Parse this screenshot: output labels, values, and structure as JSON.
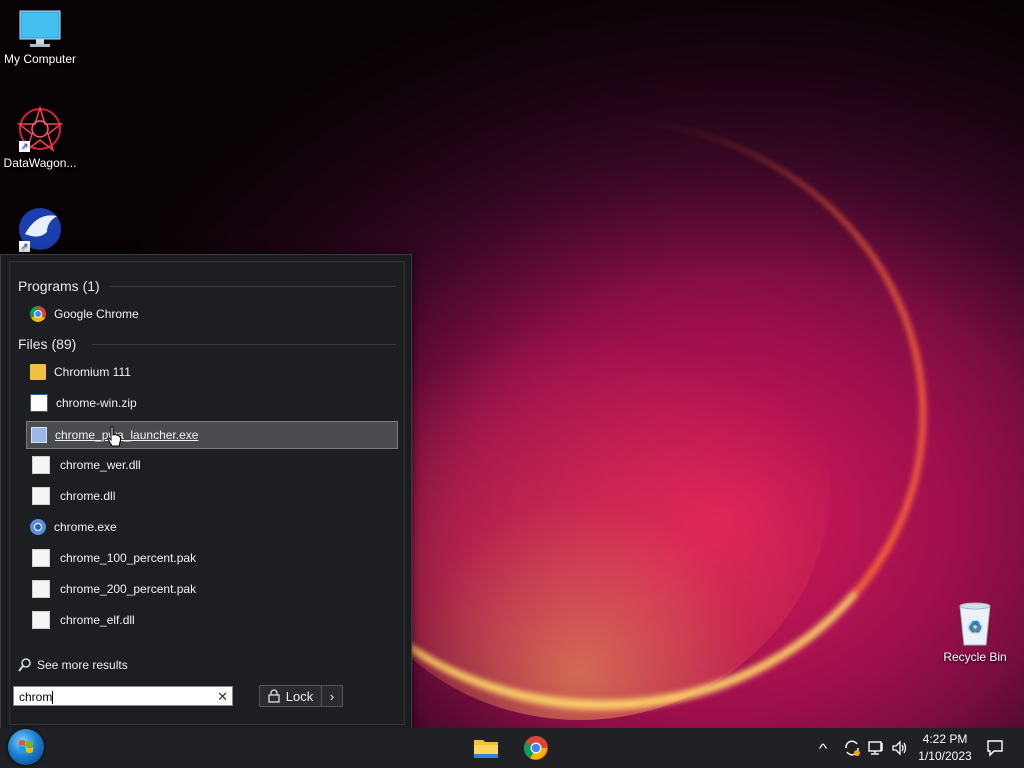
{
  "desktop": {
    "icons": [
      {
        "label": "My Computer"
      },
      {
        "label": "DataWagon..."
      },
      {
        "label": ""
      },
      {
        "label": "Recycle Bin"
      }
    ]
  },
  "search_menu": {
    "programs_header": "Programs (1)",
    "programs": [
      {
        "label": "Google Chrome",
        "icon": "chrome-icon"
      }
    ],
    "files_header": "Files (89)",
    "files": [
      {
        "label": "Chromium 111",
        "icon": "folder-icon"
      },
      {
        "label": "chrome-win.zip",
        "icon": "zip-icon"
      },
      {
        "label": "chrome_pwa_launcher.exe",
        "icon": "exe-icon",
        "selected": true
      },
      {
        "label": "chrome_wer.dll",
        "icon": "dll-icon"
      },
      {
        "label": "chrome.dll",
        "icon": "dll-icon"
      },
      {
        "label": "chrome.exe",
        "icon": "chromium-icon"
      },
      {
        "label": "chrome_100_percent.pak",
        "icon": "file-icon"
      },
      {
        "label": "chrome_200_percent.pak",
        "icon": "file-icon"
      },
      {
        "label": "chrome_elf.dll",
        "icon": "dll-icon"
      }
    ],
    "see_more": "See more results",
    "search_value": "chrom",
    "clear_glyph": "✕",
    "lock_label": "Lock",
    "lock_arrow": "›"
  },
  "taskbar": {
    "pinned": [
      "file-explorer-icon",
      "chrome-icon"
    ],
    "tray": {
      "chevron": "^",
      "time": "4:22 PM",
      "date": "1/10/2023"
    }
  }
}
